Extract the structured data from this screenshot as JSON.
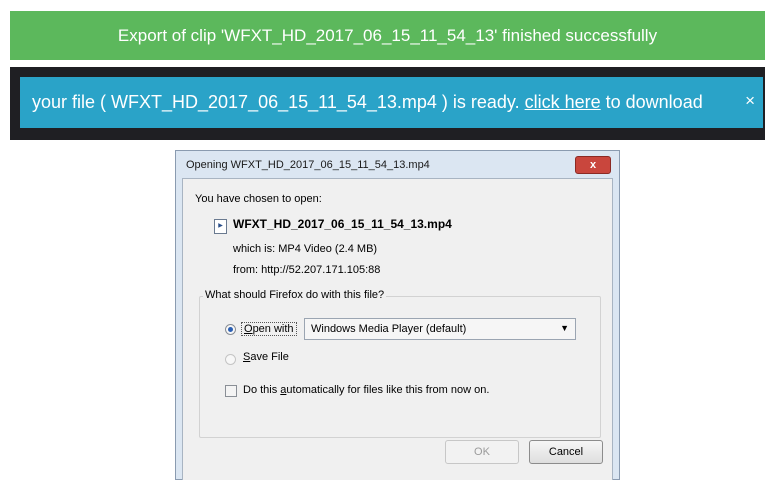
{
  "banner_success": {
    "text": "Export of clip 'WFXT_HD_2017_06_15_11_54_13' finished successfully"
  },
  "banner_info": {
    "text_before": "your file ( WFXT_HD_2017_06_15_11_54_13.mp4 ) is ready. ",
    "link_text": "click here",
    "text_after": " to download",
    "close": "×"
  },
  "dialog": {
    "title": "Opening WFXT_HD_2017_06_15_11_54_13.mp4",
    "close": "x",
    "intro": "You have chosen to open:",
    "filename": "WFXT_HD_2017_06_15_11_54_13.mp4",
    "file_icon": "media-file-icon",
    "which_is": "which is:  MP4 Video (2.4 MB)",
    "from": "from:  http://52.207.171.105:88",
    "question": "What should Firefox do with this file?",
    "open_with_label": "Open with",
    "open_with_key": "O",
    "open_with_rest": "pen with",
    "app_selected": "Windows Media Player (default)",
    "save_file_key": "S",
    "save_file_rest": "ave File",
    "auto_before": "Do this ",
    "auto_key": "a",
    "auto_after": "utomatically for files like this from now on.",
    "ok_label": "OK",
    "cancel_label": "Cancel"
  }
}
